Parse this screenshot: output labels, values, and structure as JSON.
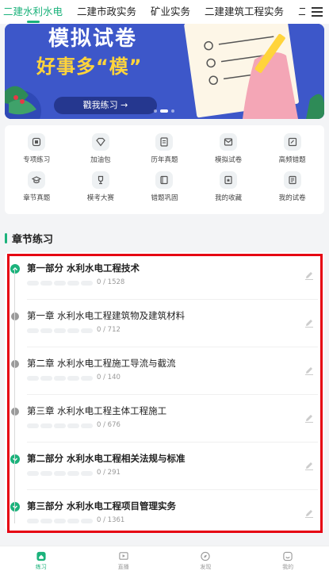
{
  "tabs": [
    {
      "label": "二建水利水电",
      "active": true
    },
    {
      "label": "二建市政实务",
      "active": false
    },
    {
      "label": "矿业实务",
      "active": false
    },
    {
      "label": "二建建筑工程实务",
      "active": false
    },
    {
      "label": "二建工程",
      "active": false
    }
  ],
  "banner": {
    "title": "模拟试卷",
    "subtitle": "好事多“模”",
    "cta": "戳我练习 →"
  },
  "grid": [
    {
      "label": "专项练习",
      "icon": "target-icon"
    },
    {
      "label": "加油包",
      "icon": "diamond-icon"
    },
    {
      "label": "历年真题",
      "icon": "document-icon"
    },
    {
      "label": "模拟试卷",
      "icon": "envelope-icon"
    },
    {
      "label": "高频错题",
      "icon": "edit-icon"
    },
    {
      "label": "章节真题",
      "icon": "graduation-icon"
    },
    {
      "label": "模考大赛",
      "icon": "trophy-icon"
    },
    {
      "label": "错题巩固",
      "icon": "book-icon"
    },
    {
      "label": "我的收藏",
      "icon": "bookmark-icon"
    },
    {
      "label": "我的试卷",
      "icon": "paper-icon"
    }
  ],
  "section": {
    "title": "章节练习"
  },
  "chapters": [
    {
      "name": "第一部分 水利水电工程技术",
      "count": "0 / 1528",
      "part": true
    },
    {
      "name": "第一章 水利水电工程建筑物及建筑材料",
      "count": "0 / 712",
      "part": false
    },
    {
      "name": "第二章 水利水电工程施工导流与截流",
      "count": "0 / 140",
      "part": false
    },
    {
      "name": "第三章 水利水电工程主体工程施工",
      "count": "0 / 676",
      "part": false
    },
    {
      "name": "第二部分 水利水电工程相关法规与标准",
      "count": "0 / 291",
      "part": true
    },
    {
      "name": "第三部分 水利水电工程项目管理实务",
      "count": "0 / 1361",
      "part": true
    }
  ],
  "nav": [
    {
      "label": "练习",
      "icon": "home-icon",
      "active": true
    },
    {
      "label": "直播",
      "icon": "live-icon",
      "active": false
    },
    {
      "label": "发现",
      "icon": "compass-icon",
      "active": false
    },
    {
      "label": "我的",
      "icon": "profile-icon",
      "active": false
    }
  ],
  "colors": {
    "accent": "#1bb27b",
    "banner": "#3d57c9",
    "highlight": "#e60012"
  }
}
